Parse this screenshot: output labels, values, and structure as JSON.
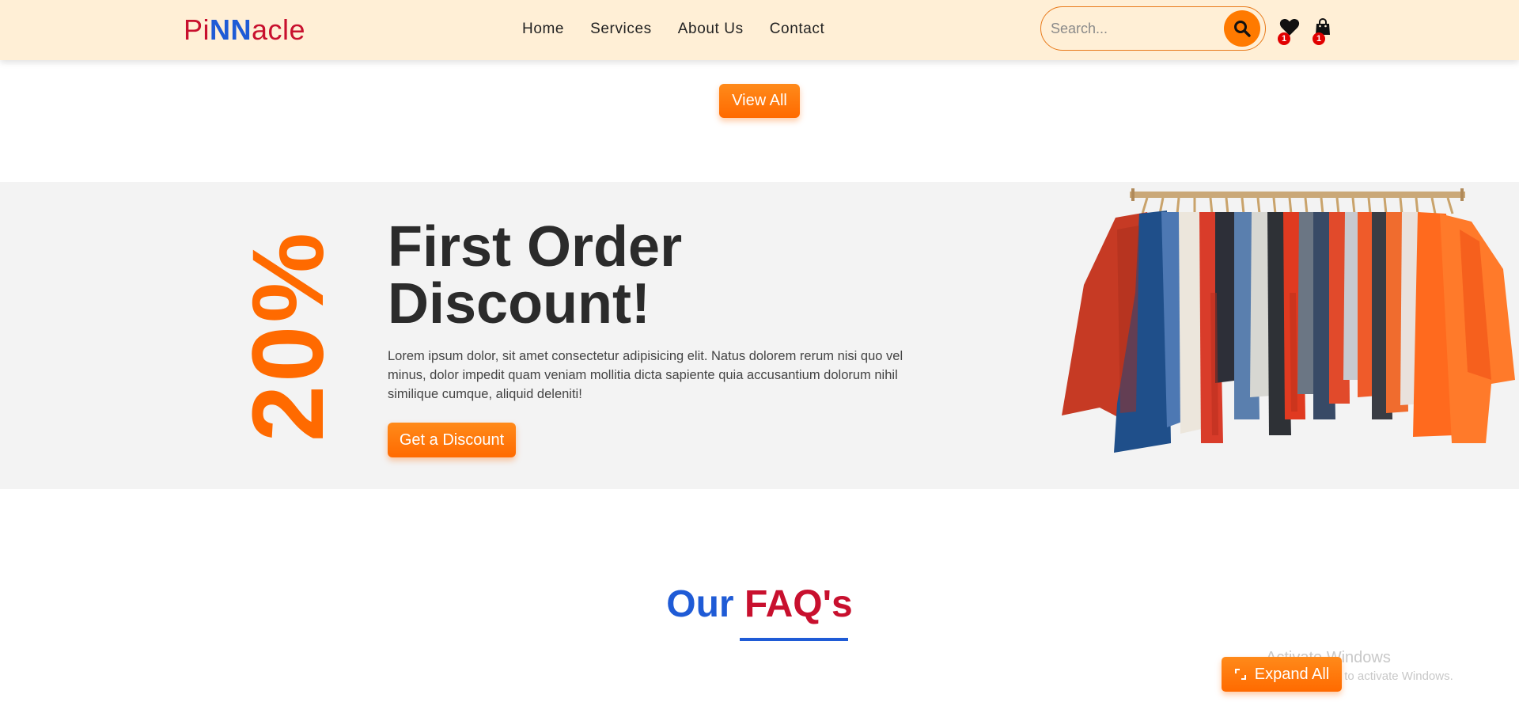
{
  "brand": {
    "logo_parts": [
      {
        "text": "Pi",
        "color": "#c8102e"
      },
      {
        "text": "NN",
        "color": "#1f5bd6"
      },
      {
        "text": "acle",
        "color": "#c8102e"
      }
    ]
  },
  "nav": {
    "items": [
      {
        "label": "Home"
      },
      {
        "label": "Services"
      },
      {
        "label": "About Us"
      },
      {
        "label": "Contact"
      }
    ]
  },
  "search": {
    "placeholder": "Search...",
    "value": "",
    "icon": "search-icon"
  },
  "header_icons": {
    "wishlist": {
      "icon": "heart-icon",
      "count": "1"
    },
    "cart": {
      "icon": "shopping-bag-icon",
      "count": "1"
    }
  },
  "products": {
    "view_all_label": "View All"
  },
  "promo": {
    "percent": "20%",
    "title_line1": "First Order",
    "title_line2": "Discount!",
    "description": "Lorem ipsum dolor, sit amet consectetur adipisicing elit. Natus dolorem rerum nisi quo vel minus, dolor impedit quam veniam mollitia dicta sapiente quia accusantium dolorum nihil similique cumque, aliquid deleniti!",
    "button_label": "Get a Discount",
    "image": "clothes-rack-image"
  },
  "faq": {
    "title_part1": "Our",
    "title_part2": "FAQ's",
    "expand_label": "Expand All"
  },
  "os_watermark": {
    "line1": "Activate Windows",
    "line2": "Go to Settings to activate Windows."
  },
  "colors": {
    "accent": "#ff6a00",
    "navbar_bg": "#ffefd6",
    "brand_blue": "#1f5bd6",
    "brand_red": "#c8102e",
    "banner_bg": "#f3f3f3",
    "badge": "#e10000"
  }
}
